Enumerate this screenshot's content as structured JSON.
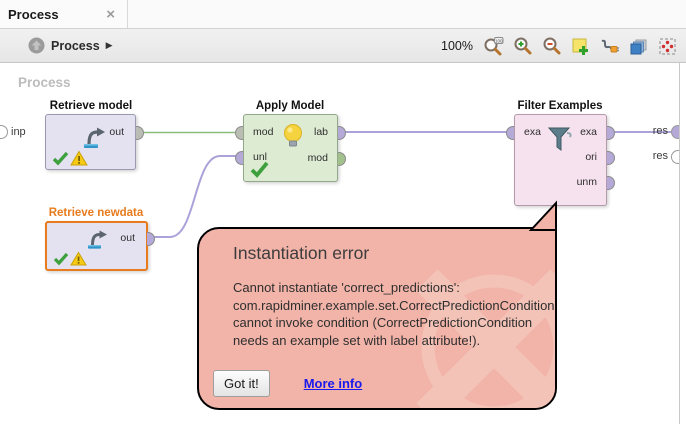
{
  "tab": {
    "title": "Process",
    "close_glyph": "×"
  },
  "toolbar": {
    "breadcrumb": {
      "label": "Process",
      "arrow": "▶"
    },
    "zoom_level": "100%",
    "icons": [
      "navigate-up",
      "zoom-reset",
      "zoom-in",
      "zoom-out",
      "add-note",
      "connections",
      "panels",
      "auto-arrange"
    ]
  },
  "canvas": {
    "label": "Process",
    "input_port": {
      "label": "inp"
    },
    "result_ports": [
      {
        "label": "res"
      },
      {
        "label": "res"
      }
    ],
    "operators": {
      "retrieve_model": {
        "name": "Retrieve model",
        "out_port": "out"
      },
      "apply_model": {
        "name": "Apply Model",
        "in_ports": [
          "mod",
          "unl"
        ],
        "out_ports": [
          "lab",
          "mod"
        ]
      },
      "filter_examples": {
        "name": "Filter Examples",
        "in_ports": [
          "exa"
        ],
        "out_ports": [
          "exa",
          "ori",
          "unm"
        ]
      },
      "retrieve_newdata": {
        "name": "Retrieve newdata",
        "out_port": "out"
      }
    }
  },
  "error_balloon": {
    "title": "Instantiation error",
    "message_lines": [
      "Cannot instantiate 'correct_predictions':",
      "com.rapidminer.example.set.CorrectPredictionCondition:",
      "cannot invoke condition (CorrectPredictionCondition",
      "needs an example set with label attribute!)."
    ],
    "confirm_label": "Got it!",
    "link_label": "More info"
  },
  "colors": {
    "selection_orange": "#e87b1e",
    "balloon_bg": "#f2b4a9",
    "balloon_watermark": "#f4c3b8",
    "wire_green": "#8cbb7a",
    "wire_purple": "#aaa2d8",
    "port_purple": "#b4a9d7",
    "port_green": "#a3c18c",
    "check_green": "#3da03d",
    "warning_yellow": "#f6c914"
  }
}
